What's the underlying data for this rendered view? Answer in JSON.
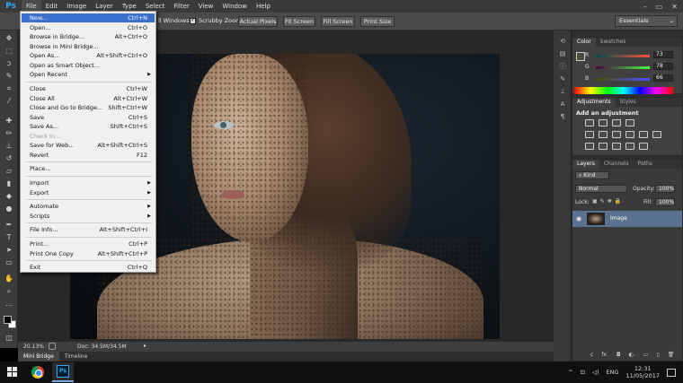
{
  "app": {
    "logo": "Ps"
  },
  "menubar": {
    "items": [
      "File",
      "Edit",
      "Image",
      "Layer",
      "Type",
      "Select",
      "Filter",
      "View",
      "Window",
      "Help"
    ],
    "window_controls": [
      "–",
      "▭",
      "✕"
    ]
  },
  "options_bar": {
    "all_windows": "ll Windows",
    "scrubby_zoom": "Scrubby Zoom",
    "buttons": [
      "Actual Pixels",
      "Fit Screen",
      "Fill Screen",
      "Print Size"
    ],
    "workspace": "Essentials"
  },
  "file_menu": {
    "items": [
      {
        "label": "New...",
        "shortcut": "Ctrl+N",
        "highlighted": true
      },
      {
        "label": "Open...",
        "shortcut": "Ctrl+O"
      },
      {
        "label": "Browse in Bridge...",
        "shortcut": "Alt+Ctrl+O"
      },
      {
        "label": "Browse in Mini Bridge...",
        "shortcut": ""
      },
      {
        "label": "Open As...",
        "shortcut": "Alt+Shift+Ctrl+O"
      },
      {
        "label": "Open as Smart Object...",
        "shortcut": ""
      },
      {
        "label": "Open Recent",
        "shortcut": "",
        "submenu": true
      },
      {
        "label": "Close",
        "shortcut": "Ctrl+W"
      },
      {
        "label": "Close All",
        "shortcut": "Alt+Ctrl+W"
      },
      {
        "label": "Close and Go to Bridge...",
        "shortcut": "Shift+Ctrl+W"
      },
      {
        "label": "Save",
        "shortcut": "Ctrl+S"
      },
      {
        "label": "Save As...",
        "shortcut": "Shift+Ctrl+S"
      },
      {
        "label": "Check In...",
        "shortcut": "",
        "disabled": true
      },
      {
        "label": "Save for Web...",
        "shortcut": "Alt+Shift+Ctrl+S"
      },
      {
        "label": "Revert",
        "shortcut": "F12"
      },
      {
        "label": "Place...",
        "shortcut": ""
      },
      {
        "label": "Import",
        "shortcut": "",
        "submenu": true
      },
      {
        "label": "Export",
        "shortcut": "",
        "submenu": true
      },
      {
        "label": "Automate",
        "shortcut": "",
        "submenu": true
      },
      {
        "label": "Scripts",
        "shortcut": "",
        "submenu": true
      },
      {
        "label": "File Info...",
        "shortcut": "Alt+Shift+Ctrl+I"
      },
      {
        "label": "Print...",
        "shortcut": "Ctrl+P"
      },
      {
        "label": "Print One Copy",
        "shortcut": "Alt+Shift+Ctrl+P"
      },
      {
        "label": "Exit",
        "shortcut": "Ctrl+Q"
      }
    ]
  },
  "status_bar": {
    "zoom": "20.13%",
    "doc": "Doc: 34.5M/34.5M"
  },
  "bottom_tabs": [
    "Mini Bridge",
    "Timeline"
  ],
  "color_panel": {
    "tabs": [
      "Color",
      "Swatches"
    ],
    "channels": [
      {
        "label": "R",
        "value": "73"
      },
      {
        "label": "G",
        "value": "78"
      },
      {
        "label": "B",
        "value": "66"
      }
    ]
  },
  "adjustments_panel": {
    "tabs": [
      "Adjustments",
      "Styles"
    ],
    "heading": "Add an adjustment"
  },
  "layers_panel": {
    "tabs": [
      "Layers",
      "Channels",
      "Paths"
    ],
    "kind": "Kind",
    "blend_mode": "Normal",
    "opacity_label": "Opacity:",
    "opacity_value": "100%",
    "lock_label": "Lock:",
    "fill_label": "Fill:",
    "fill_value": "100%",
    "layer_name": "Image",
    "bottom_icons": [
      "ⅽ",
      "fx.",
      "◘",
      "◐.",
      "▭",
      "▯",
      "🗑"
    ]
  },
  "taskbar": {
    "language": "ENG",
    "time": "12:31",
    "date": "11/05/2017",
    "ps_icon_text": "Ps"
  }
}
